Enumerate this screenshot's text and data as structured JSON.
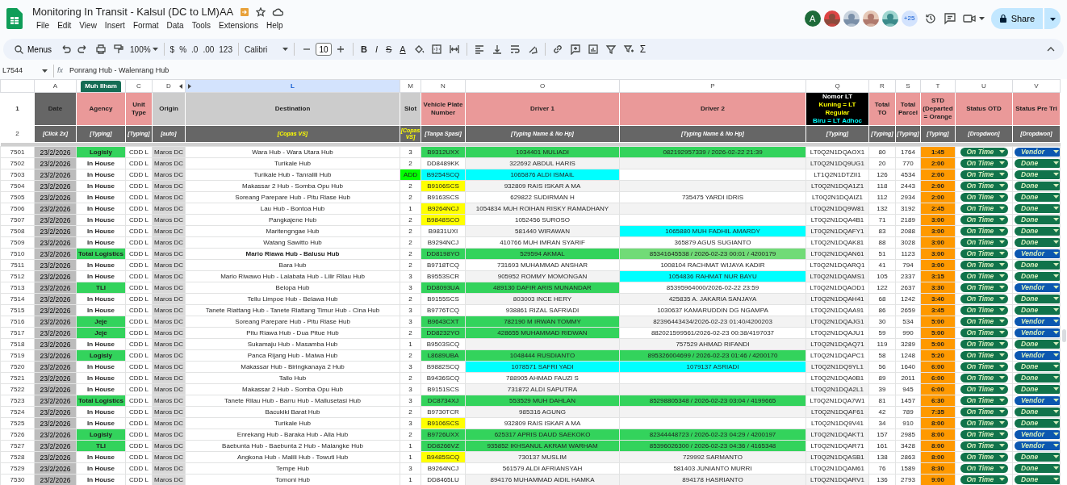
{
  "app": {
    "title": "Monitoring In Transit - Kalsul (DC to LM)AA",
    "menus": [
      "File",
      "Edit",
      "View",
      "Insert",
      "Format",
      "Data",
      "Tools",
      "Extensions",
      "Help"
    ]
  },
  "collaborators": {
    "avatars": [
      {
        "kind": "letter",
        "text": "A"
      },
      {
        "kind": "picture"
      },
      {
        "kind": "picture"
      },
      {
        "kind": "picture"
      },
      {
        "kind": "picture"
      }
    ],
    "more": "+25"
  },
  "share": {
    "label": "Share"
  },
  "toolbar": {
    "search": "Menus",
    "zoom": "100%",
    "currency": "$",
    "percent": "%",
    "decrease_decimals": ".0",
    "increase_decimals": ".00",
    "number_format": "123",
    "font": "Calibri",
    "font_size": "10",
    "format_buttons": [
      "B",
      "I",
      "S",
      "A"
    ],
    "functions": "Σ"
  },
  "formula_bar": {
    "cell": "L7544",
    "fx": "fx",
    "value": "Ponrang Hub - Walenrang Hub"
  },
  "columns": [
    {
      "letter": "A",
      "selected": false
    },
    {
      "cursor_tag": "Muh Ilham",
      "selected": false
    },
    {
      "letter": "C",
      "selected": false
    },
    {
      "letter": "D",
      "selected": false,
      "hidden_after": true
    },
    {
      "letter": "L",
      "selected": true,
      "hidden_before": true
    },
    {
      "letter": "M",
      "selected": false
    },
    {
      "letter": "N",
      "selected": false
    },
    {
      "letter": "O",
      "selected": false
    },
    {
      "letter": "P",
      "selected": false
    },
    {
      "letter": "Q",
      "selected": false
    },
    {
      "letter": "R",
      "selected": false
    },
    {
      "letter": "S",
      "selected": false
    },
    {
      "letter": "T",
      "selected": false
    },
    {
      "letter": "U",
      "selected": false
    },
    {
      "letter": "V",
      "selected": false
    }
  ],
  "frozen_rows": [
    {
      "number": "1",
      "cells": [
        {
          "text": "Date",
          "color": "#666666"
        },
        {
          "text": "Agency",
          "color": "#ea9999"
        },
        {
          "text": "Unit Type",
          "color": "#ea9999"
        },
        {
          "text": "Origin",
          "color": "#cccccc"
        },
        {
          "text": "Destination",
          "color": "#cccccc"
        },
        {
          "text": "Slot",
          "color": "#cccccc"
        },
        {
          "text": "Vehicle Plate Number",
          "color": "#ea9999"
        },
        {
          "text": "Driver 1",
          "color": "#ea9999"
        },
        {
          "text": "Driver 2",
          "color": "#ea9999"
        },
        {
          "lines": [
            {
              "text": "Nomor LT",
              "color": "#ffffff"
            },
            {
              "text": "Kuning = LT Regular",
              "color": "#ffff00"
            },
            {
              "text": "Biru = LT Adhoc",
              "color": "#00ffff"
            }
          ],
          "color": "#000000"
        },
        {
          "text": "Total TO",
          "color": "#ea9999"
        },
        {
          "text": "Total Parcel",
          "color": "#ea9999"
        },
        {
          "text": "STD (Departed = Orange",
          "color": "#ea9999"
        },
        {
          "text": "Status OTD",
          "color": "#ea9999"
        },
        {
          "text": "Status Pre Tri",
          "color": "#ea9999"
        }
      ]
    },
    {
      "number": "2",
      "cells": [
        {
          "text": "[Click 2x]",
          "color": "#ffffff"
        },
        {
          "text": "[Typing]",
          "color": "#ffffff"
        },
        {
          "text": "[Typing]",
          "color": "#ffffff"
        },
        {
          "text": "[auto]",
          "color": "#ffffff"
        },
        {
          "text": "[Copas VS]",
          "color": "#ffff00"
        },
        {
          "text": "[Copas VS]",
          "color": "#ffff00"
        },
        {
          "text": "[Tanpa Spasi]",
          "color": "#ffffff"
        },
        {
          "text": "[Typing Name & No Hp]",
          "color": "#ffffff"
        },
        {
          "text": "[Typing Name & No Hp]",
          "color": "#ffffff"
        },
        {
          "text": "[Typing]",
          "color": "#ffffff"
        },
        {
          "text": "[Typing]",
          "color": "#ffffff"
        },
        {
          "text": "[Typing]",
          "color": "#ffffff"
        },
        {
          "text": "[Typing]",
          "color": "#ffffff"
        },
        {
          "text": "[Dropdwon]",
          "color": "#ffffff"
        },
        {
          "text": "[Dropdwon]",
          "color": "#ffffff"
        }
      ]
    }
  ],
  "rows": [
    {
      "n": "7501",
      "date": "23/2/2026",
      "agency": {
        "text": "Logisly",
        "color": "#33d35c"
      },
      "unit": "CDD L",
      "origin": "Maros DC",
      "dest": "Wara Hub - Wara Utara Hub",
      "slot": "3",
      "plate": {
        "text": "B9312UXX",
        "color": "#33d35c"
      },
      "d1": {
        "text": "1034401 MULIADI",
        "color": "#33d35c"
      },
      "d2": {
        "text": "082192957339 / 2026-02-22 21:39",
        "color": "#33d35c"
      },
      "lt": "LT0Q2N1DQAOX1",
      "to": "80",
      "parcel": "1764",
      "std": "1:45",
      "otd": "On Time",
      "pre": {
        "text": "Vendor",
        "color": "#0b57b0"
      }
    },
    {
      "n": "7502",
      "date": "23/2/2026",
      "agency": "In House",
      "unit": "CDD L",
      "origin": "Maros DC",
      "dest": "Turikale Hub",
      "slot": "2",
      "plate": "DD8489KK",
      "d1": "322692 ABDUL HARIS",
      "lt": "LT0Q2N1DQ9UG1",
      "to": "20",
      "parcel": "770",
      "std": "2:00",
      "otd": "On Time",
      "pre": {
        "text": "Done",
        "color": "#11734b"
      }
    },
    {
      "n": "7503",
      "date": "23/2/2026",
      "agency": "In House",
      "unit": "CDD L",
      "origin": "Maros DC",
      "dest": "Turikale Hub - Tanralili Hub",
      "slot": {
        "text": "ADD",
        "color": "#00ff00"
      },
      "plate": {
        "text": "B9254SCQ",
        "color": "#00ffff"
      },
      "d1": {
        "text": "1065876 ALDI ISMAIL",
        "color": "#00ffff"
      },
      "lt": "LT1Q2N1DTZII1",
      "to": "126",
      "parcel": "4534",
      "std": "2:00",
      "otd": "On Time",
      "pre": {
        "text": "Done",
        "color": "#11734b"
      }
    },
    {
      "n": "7504",
      "date": "23/2/2026",
      "agency": "In House",
      "unit": "CDD L",
      "origin": "Maros DC",
      "dest": "Makassar 2 Hub - Somba Opu Hub",
      "slot": "2",
      "plate": {
        "text": "B9106SCS",
        "color": "#ffff00"
      },
      "d1": "932809 RAIS ISKAR A MA",
      "lt": "LT0Q2N1DQA1Z1",
      "to": "118",
      "parcel": "2443",
      "std": "2:00",
      "otd": "On Time",
      "pre": {
        "text": "Done",
        "color": "#11734b"
      }
    },
    {
      "n": "7505",
      "date": "23/2/2026",
      "agency": "In House",
      "unit": "CDD L",
      "origin": "Maros DC",
      "dest": "Soreang Parepare Hub - Pitu Riase Hub",
      "slot": "2",
      "plate": "B9163SCS",
      "d1": "629822 SUDIRMAN H",
      "d2": "735475 YARDI IDRIS",
      "lt": "LT0Q2N1DQAIZ1",
      "to": "112",
      "parcel": "2934",
      "std": "2:00",
      "otd": "On Time",
      "pre": {
        "text": "Done",
        "color": "#11734b"
      }
    },
    {
      "n": "7506",
      "date": "23/2/2026",
      "agency": "In House",
      "unit": "CDD L",
      "origin": "Maros DC",
      "dest": "Lau Hub - Bontoa Hub",
      "slot": "1",
      "plate": {
        "text": "B9264NCJ",
        "color": "#ffff00"
      },
      "d1": "1054834 MUH ROIHAN RISKY RAMADHANY",
      "lt": "LT0Q2N1DQ9W81",
      "to": "132",
      "parcel": "3192",
      "std": "2:45",
      "otd": "On Time",
      "pre": {
        "text": "Done",
        "color": "#11734b"
      }
    },
    {
      "n": "7507",
      "date": "23/2/2026",
      "agency": "In House",
      "unit": "CDD L",
      "origin": "Maros DC",
      "dest": "Pangkajene Hub",
      "slot": "2",
      "plate": {
        "text": "B9848SCO",
        "color": "#ffff00"
      },
      "d1": "1052456 SUROSO",
      "lt": "LT0Q2N1DQA4B1",
      "to": "71",
      "parcel": "2189",
      "std": "3:00",
      "otd": "On Time",
      "pre": {
        "text": "Done",
        "color": "#11734b"
      }
    },
    {
      "n": "7508",
      "date": "23/2/2026",
      "agency": "In House",
      "unit": "CDD L",
      "origin": "Maros DC",
      "dest": "Maritengngae Hub",
      "slot": "2",
      "plate": "B9831UXI",
      "d1": "581440 WIRAWAN",
      "d2": {
        "text": "1065880 MUH FADHIL AMARDY",
        "color": "#00ffff"
      },
      "lt": "LT0Q2N1DQAFY1",
      "to": "83",
      "parcel": "2088",
      "std": "3:00",
      "otd": "On Time",
      "pre": {
        "text": "Done",
        "color": "#11734b"
      }
    },
    {
      "n": "7509",
      "date": "23/2/2026",
      "agency": "In House",
      "unit": "CDD L",
      "origin": "Maros DC",
      "dest": "Watang Sawitto Hub",
      "slot": "2",
      "plate": "B9294NCJ",
      "d1": "410766 MUH IMRAN SYARIF",
      "d2": "365879 AGUS SUGIANTO",
      "lt": "LT0Q2N1DQAK81",
      "to": "88",
      "parcel": "3028",
      "std": "3:00",
      "otd": "On Time",
      "pre": {
        "text": "Done",
        "color": "#11734b"
      }
    },
    {
      "n": "7510",
      "date": "23/2/2026",
      "agency": {
        "text": "Total Logistics",
        "color": "#33d35c"
      },
      "unit": "CDD L",
      "origin": "Maros DC",
      "dest": {
        "text": "Mario Riawa Hub - Balusu Hub",
        "bold": true
      },
      "slot": "2",
      "plate": {
        "text": "DD8198YO",
        "color": "#33d35c"
      },
      "d1": {
        "text": "529594 AKMAL",
        "color": "#33d35c"
      },
      "d2": {
        "text": "85341645538 / 2026-02-23 00:01 / 4200179",
        "color": "#71db77"
      },
      "lt": "LT0Q2N1DQAN61",
      "to": "51",
      "parcel": "1123",
      "std": "3:00",
      "otd": "On Time",
      "pre": {
        "text": "Vendor",
        "color": "#0b57b0"
      }
    },
    {
      "n": "7511",
      "date": "23/2/2026",
      "agency": "In House",
      "unit": "CDD L",
      "origin": "Maros DC",
      "dest": "Bara Hub",
      "slot": "2",
      "plate": "B9718TCQ",
      "d1": "731693 MUHAMMAD ANSHAR",
      "d2": "1008104 RACHMAT WIJAYA KADIR",
      "lt": "LT0Q2N1DQARQ1",
      "to": "41",
      "parcel": "794",
      "std": "3:00",
      "otd": "On Time",
      "pre": {
        "text": "Done",
        "color": "#11734b"
      }
    },
    {
      "n": "7512",
      "date": "23/2/2026",
      "agency": "In House",
      "unit": "CDD L",
      "origin": "Maros DC",
      "dest": "Mario Riwawo Hub - Lalabata Hub - Lilir Rilau Hub",
      "slot": "3",
      "plate": "B9553SCR",
      "d1": "905952 ROMMY MOMONGAN",
      "d2": {
        "text": "1054836 RAHMAT NUR BAYU",
        "color": "#00ffff"
      },
      "lt": "LT0Q2N1DQAMS1",
      "to": "105",
      "parcel": "2337",
      "std": "3:15",
      "otd": "On Time",
      "pre": {
        "text": "Done",
        "color": "#11734b"
      }
    },
    {
      "n": "7513",
      "date": "23/2/2026",
      "agency": {
        "text": "TLI",
        "color": "#33d35c"
      },
      "unit": "CDD L",
      "origin": "Maros DC",
      "dest": "Belopa Hub",
      "slot": "3",
      "plate": {
        "text": "DD8093UA",
        "color": "#33d35c"
      },
      "d1": {
        "text": "489130 DAFIR ARIS MUNANDAR",
        "color": "#33d35c"
      },
      "d2": "85395964000/2026-02-22 23:59",
      "lt": "LT0Q2N1DQAOD1",
      "to": "122",
      "parcel": "2637",
      "std": "3:30",
      "otd": "On Time",
      "pre": {
        "text": "Vendor",
        "color": "#0b57b0"
      }
    },
    {
      "n": "7514",
      "date": "23/2/2026",
      "agency": "In House",
      "unit": "CDD L",
      "origin": "Maros DC",
      "dest": "Tellu Limpoe Hub - Belawa Hub",
      "slot": "2",
      "plate": "B9155SCS",
      "d1": "803003 INCE HERY",
      "d2": "425835 A. JAKARIA SANJAYA",
      "lt": "LT0Q2N1DQAH41",
      "to": "68",
      "parcel": "1242",
      "std": "3:40",
      "otd": "On Time",
      "pre": {
        "text": "Done",
        "color": "#11734b"
      }
    },
    {
      "n": "7515",
      "date": "23/2/2026",
      "agency": "In House",
      "unit": "CDD L",
      "origin": "Maros DC",
      "dest": "Tanete Riattang Hub - Tanete Riattang Timur Hub - Cina Hub",
      "slot": "3",
      "plate": "B9776TCQ",
      "d1": "938861 RIZAL SAFRIADI",
      "d2": "1030637 KAMARUDDIN DG NGAMPA",
      "lt": "LT0Q2N1DQAA91",
      "to": "86",
      "parcel": "2659",
      "std": "3:45",
      "otd": "On Time",
      "pre": {
        "text": "Done",
        "color": "#11734b"
      }
    },
    {
      "n": "7516",
      "date": "23/2/2026",
      "agency": {
        "text": "Jeje",
        "color": "#33d35c"
      },
      "unit": "CDD L",
      "origin": "Maros DC",
      "dest": "Soreang Parepare Hub - Pitu Riase Hub",
      "slot": "3",
      "plate": {
        "text": "B9643CXT",
        "color": "#33d35c"
      },
      "d1": {
        "text": "782190 M IRWAN TOMMY",
        "color": "#33d35c"
      },
      "d2": "82396443434/2026-02-23 01:40/4200203",
      "lt": "LT0Q2N1DQAJG1",
      "to": "30",
      "parcel": "534",
      "std": "5:00",
      "otd": "On Time",
      "pre": {
        "text": "Vendor",
        "color": "#0b57b0"
      }
    },
    {
      "n": "7517",
      "date": "23/2/2026",
      "agency": {
        "text": "Jeje",
        "color": "#33d35c"
      },
      "unit": "CDD L",
      "origin": "Maros DC",
      "dest": "Pitu Riawa Hub - Dua Pitue Hub",
      "slot": "2",
      "plate": {
        "text": "DD8232YO",
        "color": "#33d35c"
      },
      "d1": {
        "text": "428655 MUHAMMAD RIDWAN",
        "color": "#33d35c"
      },
      "d2": "882021599561/2026-02-23 00:38/4197037",
      "lt": "LT0Q2N1DQAJU1",
      "to": "59",
      "parcel": "990",
      "std": "5:00",
      "otd": "On Time",
      "pre": {
        "text": "Vendor",
        "color": "#0b57b0"
      }
    },
    {
      "n": "7518",
      "date": "23/2/2026",
      "agency": "In House",
      "unit": "CDD L",
      "origin": "Maros DC",
      "dest": "Sukamaju Hub - Masamba Hub",
      "slot": "1",
      "plate": "B9503SCQ",
      "d2": "757529 AHMAD RIFANDI",
      "lt": "LT0Q2N1DQAQ71",
      "to": "119",
      "parcel": "3289",
      "std": "5:00",
      "otd": "On Time",
      "pre": {
        "text": "Done",
        "color": "#11734b"
      }
    },
    {
      "n": "7519",
      "date": "23/2/2026",
      "agency": {
        "text": "Logisly",
        "color": "#33d35c"
      },
      "unit": "CDD L",
      "origin": "Maros DC",
      "dest": "Panca Rijang Hub - Maiwa Hub",
      "slot": "2",
      "plate": {
        "text": "L8689UBA",
        "color": "#33d35c"
      },
      "d1": {
        "text": "1048444 RUSDIANTO",
        "color": "#33d35c"
      },
      "d2": {
        "text": "895326004699 / 2026-02-23 01:46 / 4200170",
        "color": "#33d35c"
      },
      "lt": "LT0Q2N1DQAPC1",
      "to": "58",
      "parcel": "1248",
      "std": "5:20",
      "otd": "On Time",
      "pre": {
        "text": "Vendor",
        "color": "#0b57b0"
      }
    },
    {
      "n": "7520",
      "date": "23/2/2026",
      "agency": "In House",
      "unit": "CDD L",
      "origin": "Maros DC",
      "dest": "Makassar Hub - Biringkanaya 2 Hub",
      "slot": "3",
      "plate": "B9882SCQ",
      "d1": {
        "text": "1078571 SAFRI YADI",
        "color": "#00ffff"
      },
      "d2": {
        "text": "1079137 ASRIADI",
        "color": "#00ffff"
      },
      "lt": "LT0Q2N1DQ9YL1",
      "to": "56",
      "parcel": "1640",
      "std": "6:00",
      "otd": "On Time",
      "pre": {
        "text": "Done",
        "color": "#11734b"
      }
    },
    {
      "n": "7521",
      "date": "23/2/2026",
      "agency": "In House",
      "unit": "CDD L",
      "origin": "Maros DC",
      "dest": "Tallo Hub",
      "slot": "2",
      "plate": "B9436SCQ",
      "d1": "788905 AHMAD FAUZI S",
      "lt": "LT0Q2N1DQA0B1",
      "to": "89",
      "parcel": "2011",
      "std": "6:00",
      "otd": "On Time",
      "pre": {
        "text": "Done",
        "color": "#11734b"
      }
    },
    {
      "n": "7522",
      "date": "23/2/2026",
      "agency": "In House",
      "unit": "CDD L",
      "origin": "Maros DC",
      "dest": "Makassar 2 Hub - Somba Opu Hub",
      "slot": "3",
      "plate": "B9151SCS",
      "d1": "731872 ALDI SAPUTRA",
      "lt": "LT0Q2N1DQA2L1",
      "to": "39",
      "parcel": "945",
      "std": "6:00",
      "otd": "On Time",
      "pre": {
        "text": "Done",
        "color": "#11734b"
      }
    },
    {
      "n": "7523",
      "date": "23/2/2026",
      "agency": {
        "text": "Total Logistics",
        "color": "#33d35c"
      },
      "unit": "CDD L",
      "origin": "Maros DC",
      "dest": "Tanete Rilau Hub - Barru Hub - Mallusetasi Hub",
      "slot": "3",
      "plate": {
        "text": "DC8734XJ",
        "color": "#33d35c"
      },
      "d1": {
        "text": "553529 MUH DAHLAN",
        "color": "#33d35c"
      },
      "d2": {
        "text": "85298805348 / 2026-02-23 03:04 / 4199665",
        "color": "#33d35c"
      },
      "lt": "LT0Q2N1DQA7W1",
      "to": "81",
      "parcel": "1457",
      "std": "6:30",
      "otd": "On Time",
      "pre": {
        "text": "Vendor",
        "color": "#0b57b0"
      }
    },
    {
      "n": "7524",
      "date": "23/2/2026",
      "agency": "In House",
      "unit": "CDD L",
      "origin": "Maros DC",
      "dest": "Bacukiki Barat Hub",
      "slot": "2",
      "plate": "B9730TCR",
      "d1": "985316 AGUNG",
      "lt": "LT0Q2N1DQAF61",
      "to": "42",
      "parcel": "789",
      "std": "7:35",
      "otd": "On Time",
      "pre": {
        "text": "Done",
        "color": "#11734b"
      }
    },
    {
      "n": "7525",
      "date": "23/2/2026",
      "agency": "In House",
      "unit": "CDD L",
      "origin": "Maros DC",
      "dest": "Turikale Hub",
      "slot": "3",
      "plate": {
        "text": "B9106SCS",
        "color": "#ffff00"
      },
      "d1": "932809 RAIS ISKAR A MA",
      "lt": "LT0Q2N1DQ9V41",
      "to": "34",
      "parcel": "910",
      "std": "8:00",
      "otd": "On Time",
      "pre": {
        "text": "Done",
        "color": "#11734b"
      }
    },
    {
      "n": "7526",
      "date": "23/2/2026",
      "agency": {
        "text": "Logisly",
        "color": "#33d35c"
      },
      "unit": "CDD L",
      "origin": "Maros DC",
      "dest": "Enrekang Hub - Baraka Hub - Alla Hub",
      "slot": "2",
      "plate": {
        "text": "B9726UXX",
        "color": "#33d35c"
      },
      "d1": {
        "text": "625317 APRIS DAUD SAEKOKO",
        "color": "#33d35c"
      },
      "d2": {
        "text": "82344448723 / 2026-02-23 04:29 / 4200197",
        "color": "#33d35c"
      },
      "lt": "LT0Q2N1DQAKT1",
      "to": "157",
      "parcel": "2985",
      "std": "8:00",
      "otd": "On Time",
      "pre": {
        "text": "Vendor",
        "color": "#0b57b0"
      }
    },
    {
      "n": "7527",
      "date": "23/2/2026",
      "agency": {
        "text": "TLI",
        "color": "#33d35c"
      },
      "unit": "CDD L",
      "origin": "Maros DC",
      "dest": "Baebunta Hub - Baebunta 2 Hub - Malangke Hub",
      "slot": "1",
      "plate": {
        "text": "DD8266VZ",
        "color": "#33d35c"
      },
      "d1": {
        "text": "935852 IKHSANUL AKRAM WARHAM",
        "color": "#33d35c"
      },
      "d2": {
        "text": "85396026300 / 2026-02-23 04:36 / 4165348",
        "color": "#33d35c"
      },
      "lt": "LT0Q2N1DQAR71",
      "to": "161",
      "parcel": "3428",
      "std": "8:00",
      "otd": "On Time",
      "pre": {
        "text": "Vendor",
        "color": "#0b57b0"
      }
    },
    {
      "n": "7528",
      "date": "23/2/2026",
      "agency": "In House",
      "unit": "CDD L",
      "origin": "Maros DC",
      "dest": "Angkona Hub - Malili Hub - Towuti Hub",
      "slot": "1",
      "plate": {
        "text": "B9485SCQ",
        "color": "#ffff00"
      },
      "d1": "730137 MUSLIM",
      "d2": "729992 SARMANTO",
      "lt": "LT0Q2N1DQASB1",
      "to": "138",
      "parcel": "2863",
      "std": "8:00",
      "otd": "On Time",
      "pre": {
        "text": "Done",
        "color": "#11734b"
      }
    },
    {
      "n": "7529",
      "date": "23/2/2026",
      "agency": "In House",
      "unit": "CDD L",
      "origin": "Maros DC",
      "dest": "Tempe Hub",
      "slot": "3",
      "plate": "B9264NCJ",
      "d1": "561579 ALDI AFRIANSYAH",
      "d2": "581403 JUNIANTO MURRI",
      "lt": "LT0Q2N1DQAM61",
      "to": "76",
      "parcel": "1589",
      "std": "8:30",
      "otd": "On Time",
      "pre": {
        "text": "Done",
        "color": "#11734b"
      }
    },
    {
      "n": "7530",
      "date": "23/2/2026",
      "agency": "In House",
      "unit": "CDD L",
      "origin": "Maros DC",
      "dest": "Tomoni Hub",
      "slot": "1",
      "plate": "DD8465LU",
      "d1": "894176 MUHAMMAD AIDIL HAMKA",
      "d2": "894178 HASRIANTO",
      "lt": "LT0Q2N1DQARV1",
      "to": "136",
      "parcel": "2793",
      "std": "9:00",
      "otd": "On Time",
      "pre": {
        "text": "Done",
        "color": "#11734b"
      }
    }
  ]
}
